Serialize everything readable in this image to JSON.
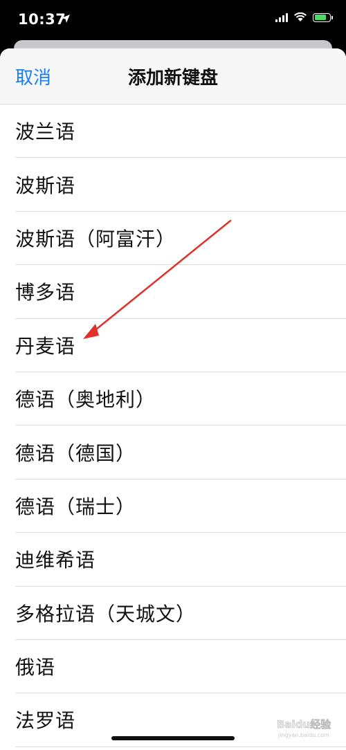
{
  "status_bar": {
    "time": "10:37"
  },
  "nav": {
    "cancel_label": "取消",
    "title": "添加新键盘"
  },
  "languages": [
    {
      "label": "波兰语"
    },
    {
      "label": "波斯语"
    },
    {
      "label": "波斯语（阿富汗）"
    },
    {
      "label": "博多语"
    },
    {
      "label": "丹麦语"
    },
    {
      "label": "德语（奥地利）"
    },
    {
      "label": "德语（德国）"
    },
    {
      "label": "德语（瑞士）"
    },
    {
      "label": "迪维希语"
    },
    {
      "label": "多格拉语（天城文）"
    },
    {
      "label": "俄语"
    },
    {
      "label": "法罗语"
    }
  ],
  "watermark": {
    "brand": "Baidu经验",
    "url": "jingyan.baidu.com"
  },
  "colors": {
    "accent": "#1a7ef2",
    "arrow": "#e0302a",
    "battery": "#4cd964"
  }
}
